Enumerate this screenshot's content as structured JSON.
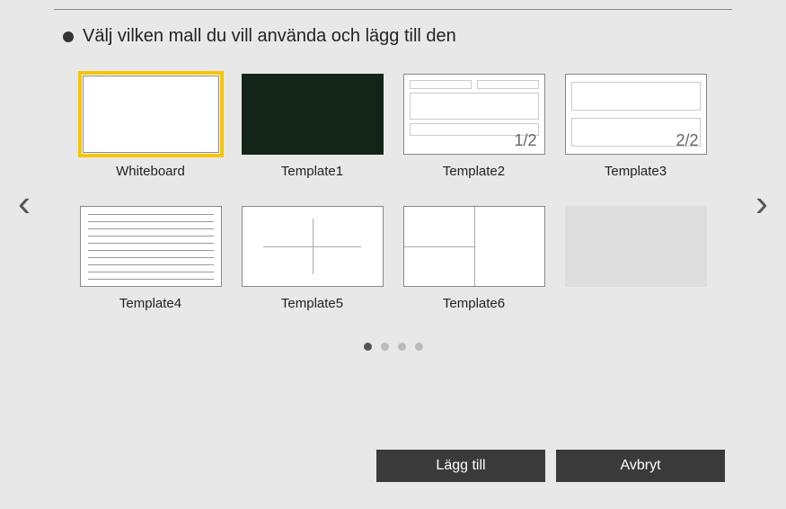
{
  "header": {
    "title": "Välj vilken mall du vill använda och lägg till den"
  },
  "templates": [
    {
      "label": "Whiteboard",
      "selected": true,
      "kind": "whiteboard"
    },
    {
      "label": "Template1",
      "selected": false,
      "kind": "dark"
    },
    {
      "label": "Template2",
      "selected": false,
      "kind": "form12",
      "page_indicator": "1/2"
    },
    {
      "label": "Template3",
      "selected": false,
      "kind": "form22",
      "page_indicator": "2/2"
    },
    {
      "label": "Template4",
      "selected": false,
      "kind": "lined"
    },
    {
      "label": "Template5",
      "selected": false,
      "kind": "cross"
    },
    {
      "label": "Template6",
      "selected": false,
      "kind": "split"
    },
    {
      "label": "",
      "selected": false,
      "kind": "empty"
    }
  ],
  "pagination": {
    "total": 4,
    "active": 0
  },
  "actions": {
    "add_label": "Lägg till",
    "cancel_label": "Avbryt"
  }
}
